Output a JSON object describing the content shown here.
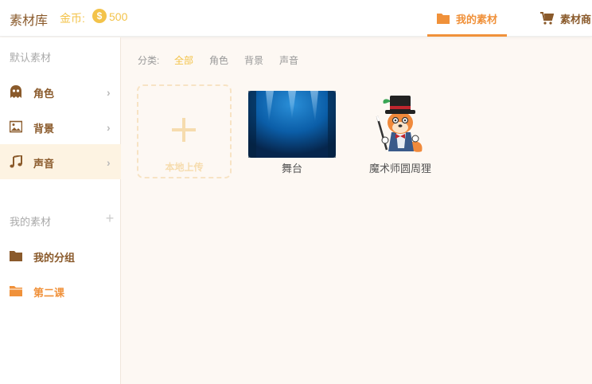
{
  "header": {
    "title": "素材库",
    "coins_label": "金币:",
    "coin_symbol": "$",
    "coins_value": "500",
    "tabs": [
      {
        "label": "我的素材",
        "active": true
      },
      {
        "label": "素材商"
      }
    ]
  },
  "sidebar": {
    "default_section": "默认素材",
    "default_items": [
      {
        "label": "角色",
        "icon": "ghost-icon"
      },
      {
        "label": "背景",
        "icon": "image-icon"
      },
      {
        "label": "声音",
        "icon": "music-note-icon",
        "active": true
      }
    ],
    "my_section": "我的素材",
    "my_items": [
      {
        "label": "我的分组",
        "icon": "folder-icon"
      },
      {
        "label": "第二课",
        "icon": "folder-open-icon"
      }
    ]
  },
  "main": {
    "filter_label": "分类:",
    "filters": [
      "全部",
      "角色",
      "背景",
      "声音"
    ],
    "upload_label": "本地上传",
    "assets": [
      {
        "name": "舞台"
      },
      {
        "name": "魔术师圆周狸"
      }
    ]
  },
  "colors": {
    "accent": "#f0913a",
    "brown": "#8a5a2b",
    "gold": "#f3c34a"
  }
}
